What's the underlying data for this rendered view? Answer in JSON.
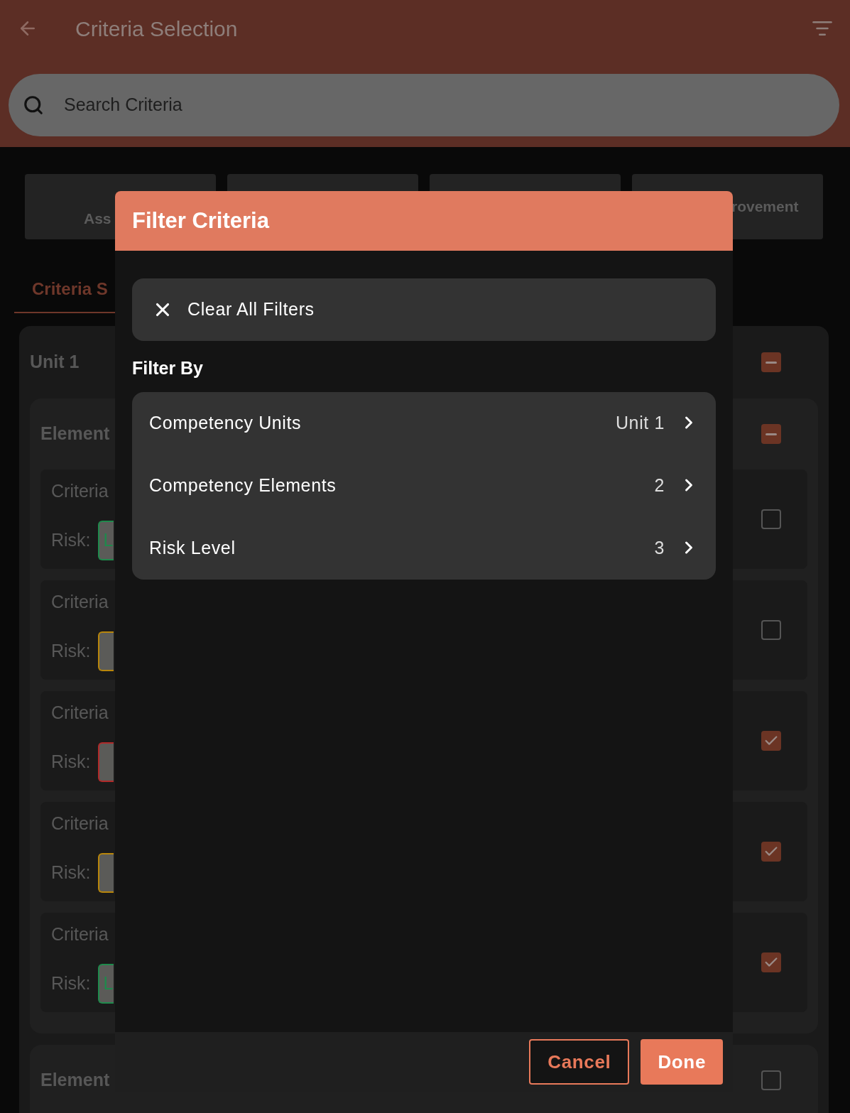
{
  "app_bar": {
    "title": "Criteria Selection"
  },
  "search": {
    "placeholder": "Search Criteria"
  },
  "summary_tiles": [
    {
      "kind": "text",
      "lines": [
        "Ass"
      ]
    },
    {
      "kind": "blank"
    },
    {
      "kind": "blank"
    },
    {
      "kind": "text",
      "lines": [
        "rovement"
      ]
    }
  ],
  "tabs": [
    {
      "label": "Criteria S",
      "selected": true
    }
  ],
  "units": [
    {
      "name": "Unit 1",
      "checked": true,
      "partial": true,
      "elements": [
        {
          "name": "Element",
          "checked": true,
          "partial": true,
          "criteria": [
            {
              "name": "Criteria",
              "risk_label": "Risk:",
              "risk": "L",
              "color": "#1f8a4c",
              "checked": false
            },
            {
              "name": "Criteria",
              "risk_label": "Risk:",
              "color": "#b8860b",
              "checked": false
            },
            {
              "name": "Criteria",
              "risk_label": "Risk:",
              "color": "#b02a2a",
              "checked": true
            },
            {
              "name": "Criteria",
              "risk_label": "Risk:",
              "color": "#b8860b",
              "checked": true
            },
            {
              "name": "Criteria",
              "risk_label": "Risk:",
              "risk": "L",
              "color": "#1f8a4c",
              "checked": true
            }
          ]
        },
        {
          "name": "Element",
          "checked": false
        }
      ]
    }
  ],
  "dialog": {
    "title": "Filter Criteria",
    "clear_button": "Clear All Filters",
    "section_title": "Filter By",
    "filters": [
      {
        "label": "Competency Units",
        "value": "Unit 1"
      },
      {
        "label": "Competency Elements",
        "value": "2"
      },
      {
        "label": "Risk Level",
        "value": "3"
      }
    ],
    "buttons": [
      {
        "label": "Cancel",
        "kind": "outlined"
      },
      {
        "label": "Done",
        "kind": "filled"
      }
    ]
  }
}
